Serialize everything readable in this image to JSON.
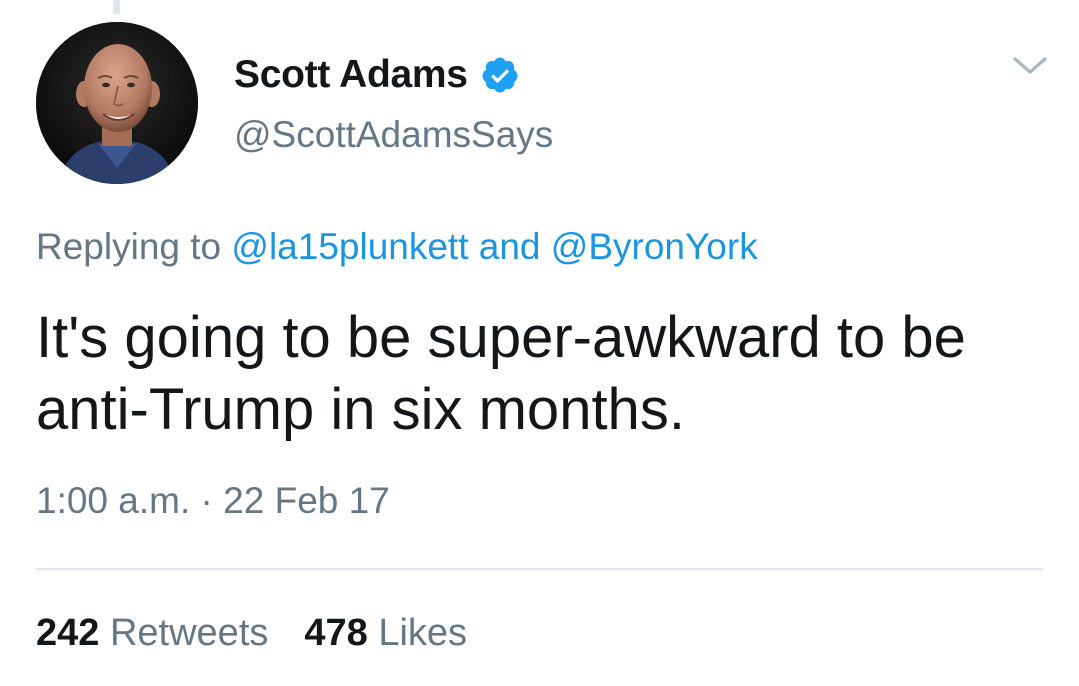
{
  "tweet": {
    "author": {
      "display_name": "Scott Adams",
      "handle": "@ScottAdamsSays",
      "verified": true
    },
    "reply": {
      "prefix": "Replying to",
      "mentions": [
        "@la15plunkett",
        "@ByronYork"
      ],
      "conjunction": "and"
    },
    "text": "It's going to be super-awkward to be anti-Trump in six months.",
    "time": "1:00 a.m.",
    "separator": "·",
    "date": "22 Feb 17",
    "stats": {
      "retweets_count": "242",
      "retweets_label": "Retweets",
      "likes_count": "478",
      "likes_label": "Likes"
    }
  },
  "colors": {
    "text": "#14171a",
    "secondary": "#657786",
    "link": "#1b95e0",
    "verified": "#1da1f2",
    "divider": "#e1e8ed"
  },
  "icons": {
    "verified": "verified-badge-icon",
    "menu": "chevron-down-icon"
  }
}
